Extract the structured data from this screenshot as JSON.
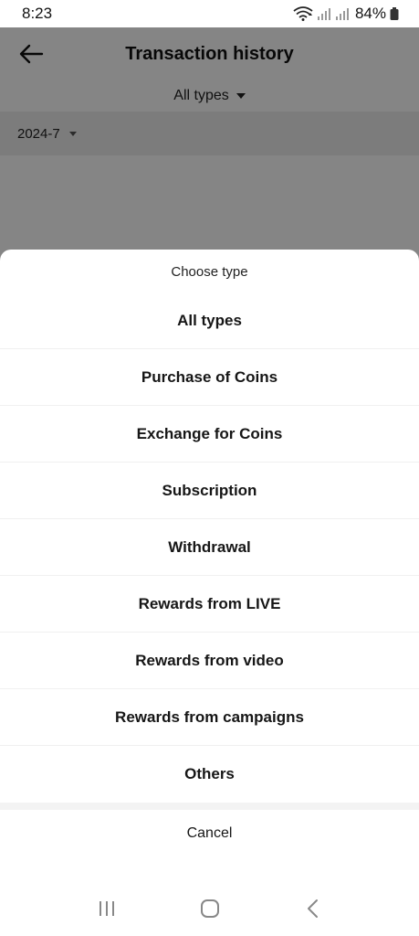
{
  "status_bar": {
    "time": "8:23",
    "battery": "84%",
    "icons": [
      "wifi-icon",
      "signal-icon",
      "signal-icon",
      "battery-icon"
    ]
  },
  "header": {
    "title": "Transaction history",
    "back_icon": "back-arrow-icon"
  },
  "filter": {
    "selected_type": "All types"
  },
  "month": {
    "label": "2024-7"
  },
  "sheet": {
    "title": "Choose type",
    "options": [
      "All types",
      "Purchase of Coins",
      "Exchange for Coins",
      "Subscription",
      "Withdrawal",
      "Rewards from LIVE",
      "Rewards from video",
      "Rewards from campaigns",
      "Others"
    ],
    "cancel_label": "Cancel"
  },
  "nav_bar": {
    "icons": [
      "recent-apps-icon",
      "home-icon",
      "back-icon"
    ]
  },
  "colors": {
    "overlay": "#000000",
    "text": "#161616",
    "divider": "#f0f0f0"
  }
}
